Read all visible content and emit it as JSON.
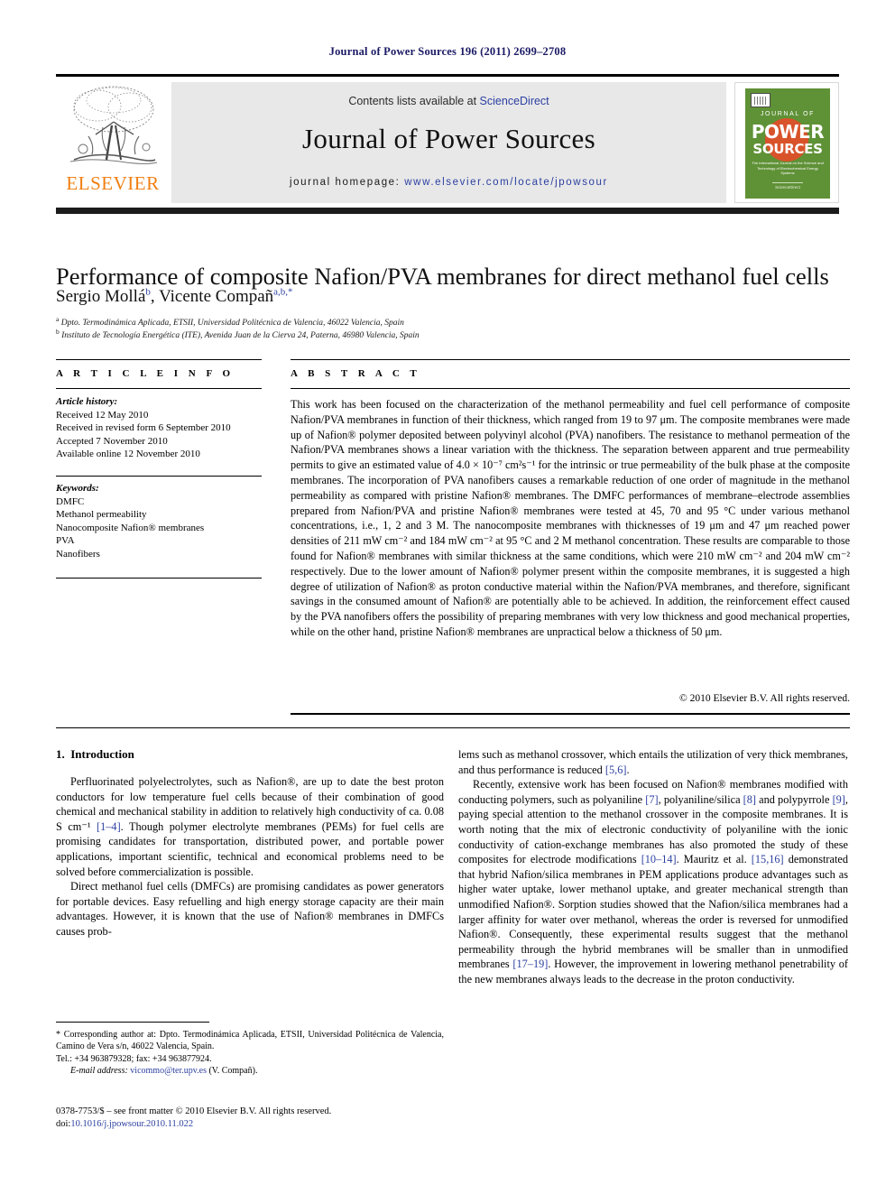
{
  "running_head": "Journal of Power Sources 196 (2011) 2699–2708",
  "masthead": {
    "contents_prefix": "Contents lists available at ",
    "sciencedirect": "ScienceDirect",
    "journal_name": "Journal of Power Sources",
    "homepage_label": "journal homepage:",
    "homepage_url": "www.elsevier.com/locate/jpowsour",
    "publisher": "ELSEVIER",
    "accent_orange": "#f07f13",
    "link_blue": "#2b3fa0",
    "band_gray": "#e8e8e8"
  },
  "cover": {
    "line1": "JOURNAL OF",
    "line2": "POWER",
    "line3": "SOURCES",
    "subtitle": "The International Journal on the Science and Technology of Electro­chemical Energy Systems",
    "sciencedirect": "ScienceDirect",
    "green": "#5f9136",
    "circle": "#d8532a"
  },
  "article": {
    "title": "Performance of composite Nafion/PVA membranes for direct methanol fuel cells",
    "authors": [
      {
        "name": "Sergio Mollá",
        "marks": "b"
      },
      {
        "name": "Vicente Compañ",
        "marks": "a,b,*"
      }
    ],
    "affiliations": [
      {
        "mark": "a",
        "text": "Dpto. Termodinámica Aplicada, ETSII, Universidad Politécnica de Valencia, 46022 Valencia, Spain"
      },
      {
        "mark": "b",
        "text": "Instituto de Tecnología Energética (ITE), Avenida Juan de la Cierva 24, Paterna, 46980 Valencia, Spain"
      }
    ]
  },
  "article_info": {
    "heading": "A R T I C L E  I N F O",
    "history_label": "Article history:",
    "history": [
      "Received 12 May 2010",
      "Received in revised form 6 September 2010",
      "Accepted 7 November 2010",
      "Available online 12 November 2010"
    ],
    "keywords_label": "Keywords:",
    "keywords": [
      "DMFC",
      "Methanol permeability",
      "Nanocomposite Nafion® membranes",
      "PVA",
      "Nanofibers"
    ]
  },
  "abstract": {
    "heading": "A B S T R A C T",
    "text": "This work has been focused on the characterization of the methanol permeability and fuel cell performance of composite Nafion/PVA membranes in function of their thickness, which ranged from 19 to 97 μm. The composite membranes were made up of Nafion® polymer deposited between polyvinyl alcohol (PVA) nanofibers. The resistance to methanol permeation of the Nafion/PVA membranes shows a linear variation with the thickness. The separation between apparent and true permeability permits to give an estimated value of 4.0 × 10⁻⁷ cm²s⁻¹ for the intrinsic or true permeability of the bulk phase at the composite membranes. The incorporation of PVA nanofibers causes a remarkable reduction of one order of magnitude in the methanol permeability as compared with pristine Nafion® membranes. The DMFC performances of membrane–electrode assemblies prepared from Nafion/PVA and pristine Nafion® membranes were tested at 45, 70 and 95 °C under various methanol concentrations, i.e., 1, 2 and 3 M. The nanocomposite membranes with thicknesses of 19 μm and 47 μm reached power densities of 211 mW cm⁻² and 184 mW cm⁻² at 95 °C and 2 M methanol concentration. These results are comparable to those found for Nafion® membranes with similar thickness at the same conditions, which were 210 mW cm⁻² and 204 mW cm⁻² respectively. Due to the lower amount of Nafion® polymer present within the composite membranes, it is suggested a high degree of utilization of Nafion® as proton conductive material within the Nafion/PVA membranes, and therefore, significant savings in the consumed amount of Nafion® are potentially able to be achieved. In addition, the reinforcement effect caused by the PVA nanofibers offers the possibility of preparing membranes with very low thickness and good mechanical properties, while on the other hand, pristine Nafion® membranes are unpractical below a thickness of 50 μm.",
    "copyright": "© 2010 Elsevier B.V. All rights reserved."
  },
  "introduction": {
    "section_number": "1.",
    "section_title": "Introduction",
    "left_paragraphs": [
      "Perfluorinated polyelectrolytes, such as Nafion®, are up to date the best proton conductors for low temperature fuel cells because of their combination of good chemical and mechanical stability in addition to relatively high conductivity of ca. 0.08 S cm⁻¹ [1–4]. Though polymer electrolyte membranes (PEMs) for fuel cells are promising candidates for transportation, distributed power, and portable power applications, important scientific, technical and economical problems need to be solved before commercialization is possible.",
      "Direct methanol fuel cells (DMFCs) are promising candidates as power generators for portable devices. Easy refuelling and high energy storage capacity are their main advantages. However, it is known that the use of Nafion® membranes in DMFCs causes prob-"
    ],
    "right_paragraphs": [
      "lems such as methanol crossover, which entails the utilization of very thick membranes, and thus performance is reduced [5,6].",
      "Recently, extensive work has been focused on Nafion® membranes modified with conducting polymers, such as polyaniline [7], polyaniline/silica [8] and polypyrrole [9], paying special attention to the methanol crossover in the composite membranes. It is worth noting that the mix of electronic conductivity of polyaniline with the ionic conductivity of cation-exchange membranes has also promoted the study of these composites for electrode modifications [10–14]. Mauritz et al. [15,16] demonstrated that hybrid Nafion/silica membranes in PEM applications produce advantages such as higher water uptake, lower methanol uptake, and greater mechanical strength than unmodified Nafion®. Sorption studies showed that the Nafion/silica membranes had a larger affinity for water over methanol, whereas the order is reversed for unmodified Nafion®. Consequently, these experimental results suggest that the methanol permeability through the hybrid membranes will be smaller than in unmodified membranes [17–19]. However, the improvement in lowering methanol penetrability of the new membranes always leads to the decrease in the proton conductivity."
    ],
    "citations": [
      "[1–4]",
      "[5,6]",
      "[7]",
      "[8]",
      "[9]",
      "[10–14]",
      "[15,16]",
      "[17–19]"
    ]
  },
  "footnote": {
    "corresponding": "* Corresponding author at: Dpto. Termodinámica Aplicada, ETSII, Universidad Politécnica de Valencia, Camino de Vera s/n, 46022 Valencia, Spain.",
    "tel": "Tel.: +34 963879328; fax: +34 963877924.",
    "email_label": "E-mail address:",
    "email": "vicommo@ter.upv.es",
    "email_owner": "(V. Compañ).",
    "issn_line": "0378-7753/$ – see front matter © 2010 Elsevier B.V. All rights reserved.",
    "doi_label": "doi:",
    "doi": "10.1016/j.jpowsour.2010.11.022"
  }
}
